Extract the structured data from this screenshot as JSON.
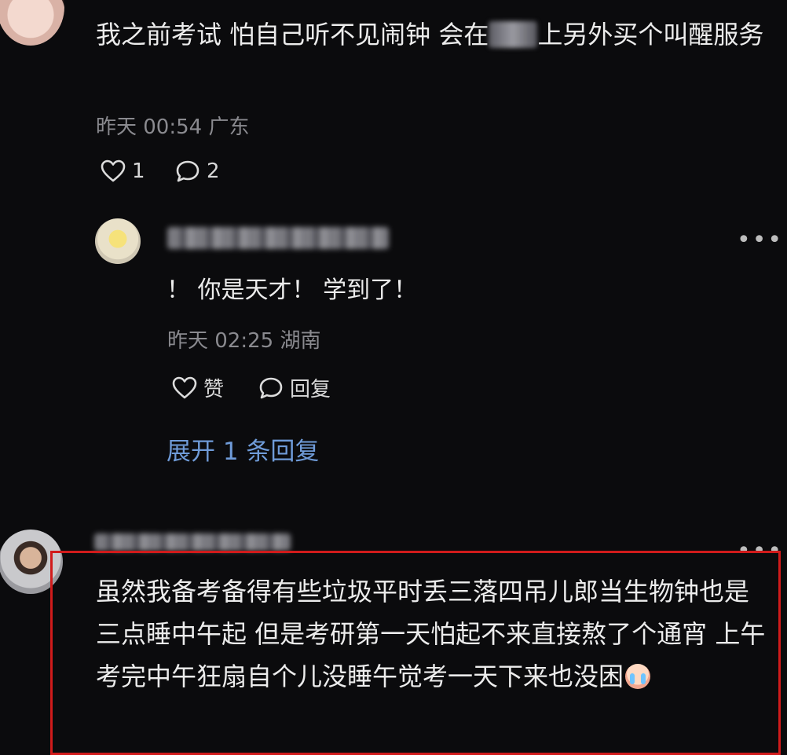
{
  "comment_1": {
    "text_part1": "我之前考试 怕自己听不见闹钟 会在",
    "text_part2": "上另外买个叫醒服务",
    "time": "昨天 00:54 广东",
    "like_count": "1",
    "reply_count": "2"
  },
  "reply_1": {
    "text": "！ 你是天才！ 学到了！",
    "time": "昨天 02:25 湖南",
    "like_label": "赞",
    "reply_label": "回复",
    "expand_label": "展开 1 条回复"
  },
  "comment_3": {
    "text": "虽然我备考备得有些垃圾平时丢三落四吊儿郎当生物钟也是三点睡中午起 但是考研第一天怕起不来直接熬了个通宵 上午考完中午狂扇自个儿没睡午觉考一天下来也没困"
  },
  "icons": {
    "like": "heart-outline-icon",
    "comment": "chat-bubble-icon",
    "more": "more-dots-icon",
    "emoji": "crying-face-emoji"
  },
  "colors": {
    "background": "#0b0b0d",
    "link": "#6f9bd8",
    "highlight_border": "#d11b1b",
    "meta": "#8a8a8f"
  }
}
